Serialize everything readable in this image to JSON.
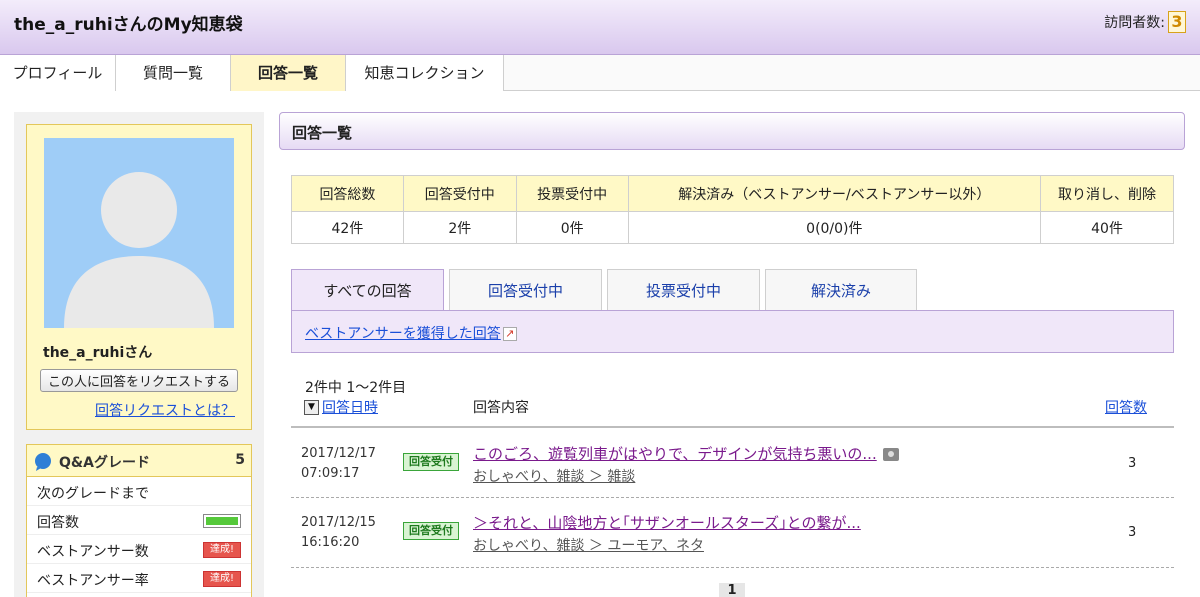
{
  "header": {
    "title": "the_a_ruhiさんのMy知恵袋",
    "visitors_label": "訪問者数:",
    "visitors_count": "3"
  },
  "nav": {
    "tabs": [
      {
        "label": "プロフィール"
      },
      {
        "label": "質問一覧"
      },
      {
        "label": "回答一覧"
      },
      {
        "label": "知恵コレクション"
      }
    ]
  },
  "profile": {
    "username": "the_a_ruhiさん",
    "request_button": "この人に回答をリクエストする",
    "request_link": "回答リクエストとは？"
  },
  "grade": {
    "title": "Q&Aグレード",
    "value": "5",
    "rows": [
      {
        "label": "次のグレードまで"
      },
      {
        "label": "回答数"
      },
      {
        "label": "ベストアンサー数",
        "badge": "達成!"
      },
      {
        "label": "ベストアンサー率",
        "badge": "達成!"
      }
    ],
    "answer_progress": 1.0
  },
  "main": {
    "title": "回答一覧",
    "summary": {
      "headers": [
        "回答総数",
        "回答受付中",
        "投票受付中",
        "解決済み（ベストアンサー/ベストアンサー以外）",
        "取り消し、削除"
      ],
      "values": [
        "42件",
        "2件",
        "0件",
        "0(0/0)件",
        "40件"
      ]
    },
    "tabs": [
      {
        "label": "すべての回答"
      },
      {
        "label": "回答受付中"
      },
      {
        "label": "投票受付中"
      },
      {
        "label": "解決済み"
      }
    ],
    "best_answer_link": "ベストアンサーを獲得した回答",
    "count_text": "2件中 1〜2件目",
    "columns": {
      "date": "回答日時",
      "content": "回答内容",
      "count": "回答数"
    },
    "rows": [
      {
        "date": "2017/12/17",
        "time": "07:09:17",
        "status": "回答受付",
        "title": "このごろ、遊覧列車がはやりで、デザインが気持ち悪いの...",
        "category": "おしゃべり、雑談 ＞ 雑談",
        "answers": "3",
        "has_image": true
      },
      {
        "date": "2017/12/15",
        "time": "16:16:20",
        "status": "回答受付",
        "title": "＞それと、山陰地方と｢サザンオールスターズ｣との繋が...",
        "category": "おしゃべり、雑談 ＞ ユーモア、ネタ",
        "answers": "3",
        "has_image": false
      }
    ],
    "page": "1"
  }
}
